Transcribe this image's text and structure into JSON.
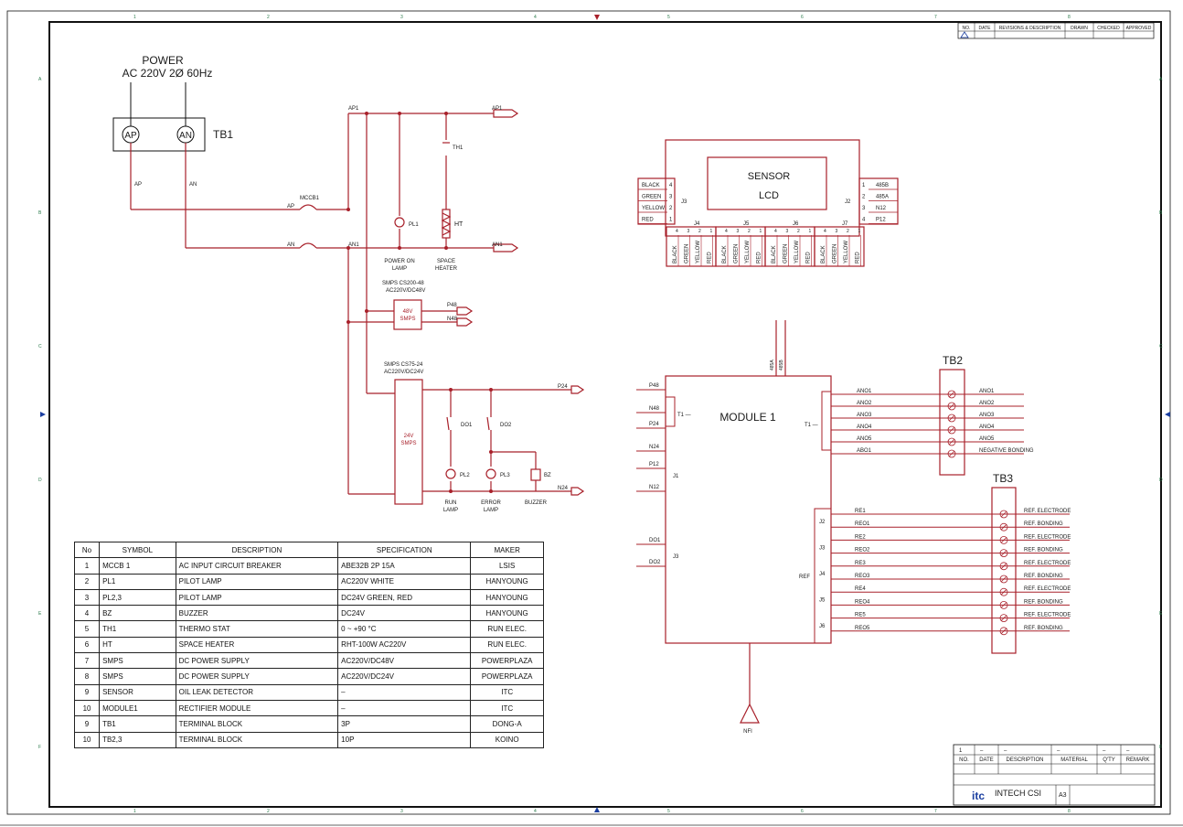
{
  "power": {
    "title": "POWER",
    "spec": "AC 220V 2Ø 60Hz"
  },
  "tb1": {
    "label": "TB1",
    "ap": "AP",
    "an": "AN"
  },
  "nets": {
    "ap": "AP",
    "an": "AN",
    "ap1": "AP1",
    "an1": "AN1",
    "p48": "P48",
    "n48": "N48",
    "p24": "P24",
    "n24": "N24"
  },
  "mccb": "MCCB1",
  "th": "TH1",
  "ht": "HT",
  "pl1": "PL1",
  "pl2": "PL2",
  "pl3": "PL3",
  "do1": "DO1",
  "do2": "DO2",
  "bz": "BZ",
  "lamps": {
    "power_on": [
      "POWER ON",
      "LAMP"
    ],
    "space_heater": [
      "SPACE",
      "HEATER"
    ],
    "run": [
      "RUN",
      "LAMP"
    ],
    "error": [
      "ERROR",
      "LAMP"
    ],
    "buzzer": "BUZZER"
  },
  "smps48": {
    "spec": [
      "SMPS CS200-48",
      "AC220V/DC48V"
    ],
    "label": [
      "48V",
      "SMPS"
    ]
  },
  "smps24": {
    "spec": [
      "SMPS CS75-24",
      "AC220V/DC24V"
    ],
    "label": [
      "24V",
      "SMPS"
    ]
  },
  "sensor": {
    "title": [
      "SENSOR",
      "LCD"
    ],
    "j3": "J3",
    "j2": "J2",
    "left_pins": [
      "BLACK",
      "GREEN",
      "YELLOW",
      "RED"
    ],
    "left_nums": [
      "4",
      "3",
      "2",
      "1"
    ],
    "right_pins": [
      "485B",
      "485A",
      "N12",
      "P12"
    ],
    "right_nums": [
      "1",
      "2",
      "3",
      "4"
    ],
    "bottom_headers": [
      "J4",
      "J5",
      "J6",
      "J7"
    ],
    "bottom_pins": [
      "BLACK",
      "GREEN",
      "YELLOW",
      "RED"
    ],
    "bottom_nums": [
      "4",
      "3",
      "2",
      "1"
    ]
  },
  "module": {
    "title": "MODULE 1",
    "top_pins": [
      "485A",
      "485B"
    ],
    "left_pins": [
      "P48",
      "N48",
      "P24",
      "N24",
      "P12",
      "N12",
      "DO1",
      "DO2"
    ],
    "left_conn": [
      "T1",
      "J1",
      "J3"
    ],
    "right_pins": [
      "ANO1",
      "ANO2",
      "ANO3",
      "ANO4",
      "ANO5",
      "ABO1"
    ],
    "right_conn": "T1",
    "ref_pins": [
      "RE1",
      "REO1",
      "RE2",
      "REO2",
      "RE3",
      "REO3",
      "RE4",
      "REO4",
      "RE5",
      "REO5"
    ],
    "ref_conn": [
      "J2",
      "J3",
      "J4",
      "J5",
      "J6"
    ],
    "ref_label": "REF",
    "ground": "NFI"
  },
  "tb2": {
    "label": "TB2",
    "outputs": [
      "ANO1",
      "ANO2",
      "ANO3",
      "ANO4",
      "ANO5",
      "NEGATIVE BONDING"
    ]
  },
  "tb3": {
    "label": "TB3",
    "outputs": [
      "REF. ELECTRODE",
      "REF. BONDING",
      "REF. ELECTRODE",
      "REF. BONDING",
      "REF. ELECTRODE",
      "REF. BONDING",
      "REF. ELECTRODE",
      "REF. BONDING",
      "REF. ELECTRODE",
      "REF. BONDING"
    ]
  },
  "bom": {
    "headers": [
      "No",
      "SYMBOL",
      "DESCRIPTION",
      "SPECIFICATION",
      "MAKER"
    ],
    "rows": [
      [
        "1",
        "MCCB 1",
        "AC INPUT CIRCUIT BREAKER",
        "ABE32B 2P 15A",
        "LSIS"
      ],
      [
        "2",
        "PL1",
        "PILOT LAMP",
        "AC220V WHITE",
        "HANYOUNG"
      ],
      [
        "3",
        "PL2,3",
        "PILOT LAMP",
        "DC24V GREEN, RED",
        "HANYOUNG"
      ],
      [
        "4",
        "BZ",
        "BUZZER",
        "DC24V",
        "HANYOUNG"
      ],
      [
        "5",
        "TH1",
        "THERMO STAT",
        "0 ~ +90 °C",
        "RUN ELEC."
      ],
      [
        "6",
        "HT",
        "SPACE HEATER",
        "RHT-100W AC220V",
        "RUN ELEC."
      ],
      [
        "7",
        "SMPS",
        "DC POWER SUPPLY",
        "AC220V/DC48V",
        "POWERPLAZA"
      ],
      [
        "8",
        "SMPS",
        "DC POWER SUPPLY",
        "AC220V/DC24V",
        "POWERPLAZA"
      ],
      [
        "9",
        "SENSOR",
        "OIL LEAK DETECTOR",
        "–",
        "ITC"
      ],
      [
        "10",
        "MODULE1",
        "RECTIFIER MODULE",
        "–",
        "ITC"
      ],
      [
        "9",
        "TB1",
        "TERMINAL BLOCK",
        "3P",
        "DONG-A"
      ],
      [
        "10",
        "TB2,3",
        "TERMINAL BLOCK",
        "10P",
        "KOINO"
      ]
    ]
  },
  "revision": {
    "headers": [
      "NO.",
      "DATE",
      "REVISIONS & DESCRIPTION",
      "DRAWN",
      "CHECKED",
      "APPROVED"
    ]
  },
  "titleblock": {
    "row1": [
      "1",
      "–",
      "–",
      "–",
      "–",
      "–"
    ],
    "headers": [
      "NO.",
      "DATE",
      "DESCRIPTION",
      "MATERIAL",
      "Q'TY",
      "REMARK"
    ],
    "logo": "itc",
    "company": "INTECH CSI",
    "size": "A3"
  },
  "border": {
    "cols": [
      "1",
      "2",
      "3",
      "4",
      "5",
      "6",
      "7",
      "8"
    ],
    "rows": [
      "A",
      "B",
      "C",
      "D",
      "E",
      "F"
    ]
  }
}
